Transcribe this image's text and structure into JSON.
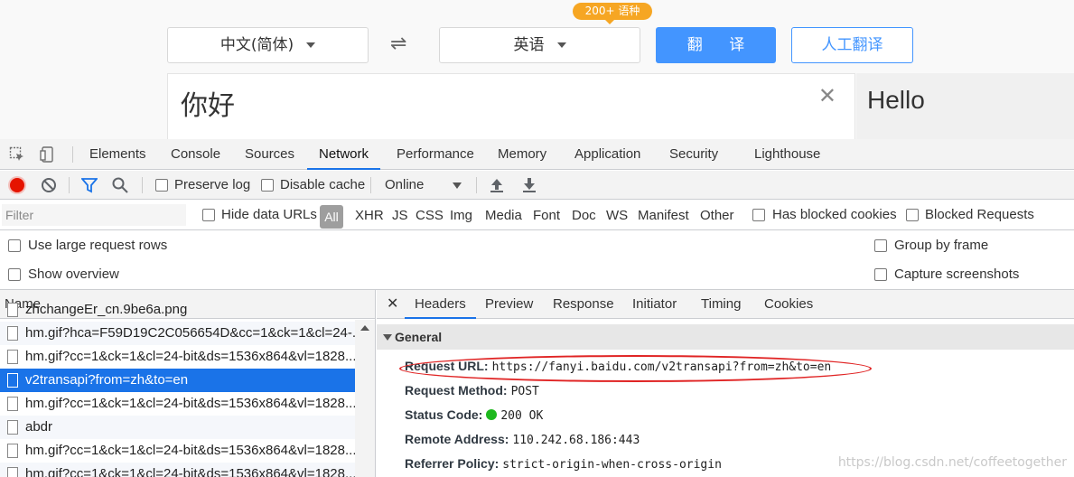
{
  "translator": {
    "badge": "200+ 语种",
    "source_lang": "中文(简体)",
    "swap_glyph": "⇌",
    "target_lang": "英语",
    "translate_button": "翻 译",
    "human_button": "人工翻译",
    "source_text": "你好",
    "clear_glyph": "✕",
    "output_text": "Hello"
  },
  "devtools": {
    "tabs": [
      "Elements",
      "Console",
      "Sources",
      "Network",
      "Performance",
      "Memory",
      "Application",
      "Security",
      "Lighthouse"
    ],
    "active_tab": "Network",
    "toolbar": {
      "preserve_log": "Preserve log",
      "disable_cache": "Disable cache",
      "throttle": "Online"
    },
    "filter": {
      "placeholder": "Filter",
      "hide_data_urls": "Hide data URLs",
      "all": "All",
      "types": [
        "XHR",
        "JS",
        "CSS",
        "Img",
        "Media",
        "Font",
        "Doc",
        "WS",
        "Manifest",
        "Other"
      ],
      "has_blocked_cookies": "Has blocked cookies",
      "blocked_requests": "Blocked Requests"
    },
    "options": {
      "large_rows": "Use large request rows",
      "show_overview": "Show overview",
      "group_by_frame": "Group by frame",
      "capture_screenshots": "Capture screenshots"
    },
    "list": {
      "header": "Name",
      "rows": [
        "zhchangeEr_cn.9be6a.png",
        "hm.gif?hca=F59D19C2C056654D&cc=1&ck=1&cl=24-...",
        "hm.gif?cc=1&ck=1&cl=24-bit&ds=1536x864&vl=1828...",
        "v2transapi?from=zh&to=en",
        "hm.gif?cc=1&ck=1&cl=24-bit&ds=1536x864&vl=1828...",
        "abdr",
        "hm.gif?cc=1&ck=1&cl=24-bit&ds=1536x864&vl=1828...",
        "hm.gif?cc=1&ck=1&cl=24-bit&ds=1536x864&vl=1828..."
      ],
      "selected_index": 3
    },
    "detail": {
      "close_glyph": "✕",
      "tabs": [
        "Headers",
        "Preview",
        "Response",
        "Initiator",
        "Timing",
        "Cookies"
      ],
      "active_tab": "Headers",
      "section": "General",
      "fields": [
        {
          "key": "Request URL:",
          "value": "https://fanyi.baidu.com/v2transapi?from=zh&to=en"
        },
        {
          "key": "Request Method:",
          "value": "POST"
        },
        {
          "key": "Status Code:",
          "value": "200 OK"
        },
        {
          "key": "Remote Address:",
          "value": "110.242.68.186:443"
        },
        {
          "key": "Referrer Policy:",
          "value": "strict-origin-when-cross-origin"
        }
      ]
    },
    "watermark": "https://blog.csdn.net/coffeetogether"
  }
}
